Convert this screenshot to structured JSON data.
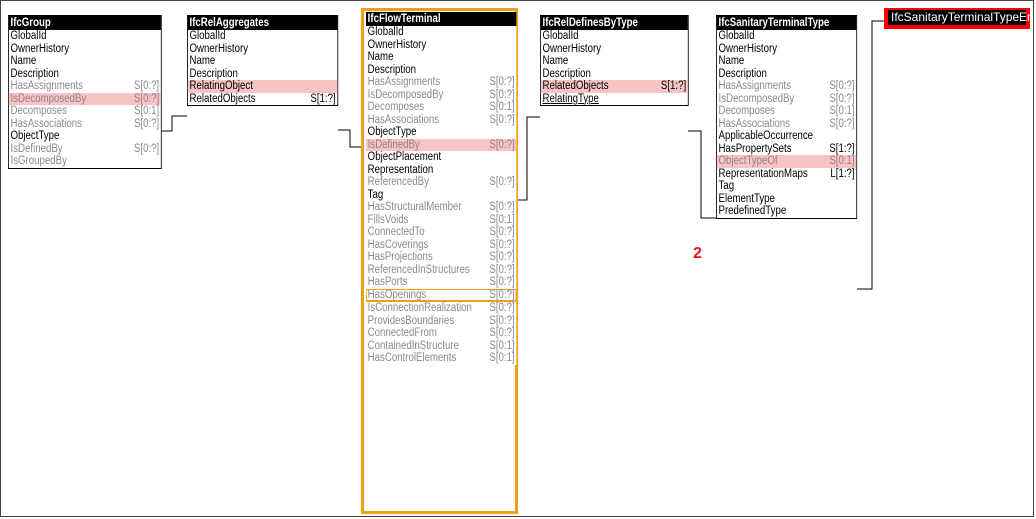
{
  "entities": [
    {
      "title": "IfcGroup",
      "rows": [
        {
          "name": "GlobalId",
          "card": ""
        },
        {
          "name": "OwnerHistory",
          "card": ""
        },
        {
          "name": "Name",
          "card": ""
        },
        {
          "name": "Description",
          "card": ""
        },
        {
          "name": "HasAssignments",
          "card": "S[0:?]",
          "inverse": true
        },
        {
          "name": "IsDecomposedBy",
          "card": "S[0:?]",
          "inverse": true,
          "highlight": true
        },
        {
          "name": "Decomposes",
          "card": "S[0:1]",
          "inverse": true
        },
        {
          "name": "HasAssociations",
          "card": "S[0:?]",
          "inverse": true
        },
        {
          "name": "ObjectType",
          "card": ""
        },
        {
          "name": "IsDefinedBy",
          "card": "S[0:?]",
          "inverse": true
        },
        {
          "name": "IsGroupedBy",
          "card": "",
          "inverse": true
        }
      ]
    },
    {
      "title": "IfcRelAggregates",
      "rows": [
        {
          "name": "GlobalId",
          "card": ""
        },
        {
          "name": "OwnerHistory",
          "card": ""
        },
        {
          "name": "Name",
          "card": ""
        },
        {
          "name": "Description",
          "card": ""
        },
        {
          "name": "RelatingObject",
          "card": "",
          "highlight": true
        },
        {
          "name": "RelatedObjects",
          "card": "S[1:?]"
        }
      ]
    },
    {
      "title": "IfcFlowTerminal",
      "rows": [
        {
          "name": "GlobalId",
          "card": ""
        },
        {
          "name": "OwnerHistory",
          "card": ""
        },
        {
          "name": "Name",
          "card": ""
        },
        {
          "name": "Description",
          "card": ""
        },
        {
          "name": "HasAssignments",
          "card": "S[0:?]",
          "inverse": true
        },
        {
          "name": "IsDecomposedBy",
          "card": "S[0:?]",
          "inverse": true
        },
        {
          "name": "Decomposes",
          "card": "S[0:1]",
          "inverse": true
        },
        {
          "name": "HasAssociations",
          "card": "S[0:?]",
          "inverse": true
        },
        {
          "name": "ObjectType",
          "card": ""
        },
        {
          "name": "IsDefinedBy",
          "card": "S[0:?]",
          "inverse": true,
          "highlight": true
        },
        {
          "name": "ObjectPlacement",
          "card": ""
        },
        {
          "name": "Representation",
          "card": ""
        },
        {
          "name": "ReferencedBy",
          "card": "S[0:?]",
          "inverse": true
        },
        {
          "name": "Tag",
          "card": ""
        },
        {
          "name": "HasStructuralMember",
          "card": "S[0:?]",
          "inverse": true
        },
        {
          "name": "FillsVoids",
          "card": "S[0:1]",
          "inverse": true
        },
        {
          "name": "ConnectedTo",
          "card": "S[0:?]",
          "inverse": true
        },
        {
          "name": "HasCoverings",
          "card": "S[0:?]",
          "inverse": true
        },
        {
          "name": "HasProjections",
          "card": "S[0:?]",
          "inverse": true
        },
        {
          "name": "ReferencedInStructures",
          "card": "S[0:?]",
          "inverse": true
        },
        {
          "name": "HasPorts",
          "card": "S[0:?]",
          "inverse": true
        },
        {
          "name": "HasOpenings",
          "card": "S[0:?]",
          "inverse": true,
          "boxed": true
        },
        {
          "name": "IsConnectionRealization",
          "card": "S[0:?]",
          "inverse": true
        },
        {
          "name": "ProvidesBoundaries",
          "card": "S[0:?]",
          "inverse": true
        },
        {
          "name": "ConnectedFrom",
          "card": "S[0:?]",
          "inverse": true
        },
        {
          "name": "ContainedInStructure",
          "card": "S[0:1]",
          "inverse": true
        },
        {
          "name": "HasControlElements",
          "card": "S[0:1]",
          "inverse": true
        }
      ]
    },
    {
      "title": "IfcRelDefinesByType",
      "rows": [
        {
          "name": "GlobalId",
          "card": ""
        },
        {
          "name": "OwnerHistory",
          "card": ""
        },
        {
          "name": "Name",
          "card": ""
        },
        {
          "name": "Description",
          "card": ""
        },
        {
          "name": "RelatedObjects",
          "card": "S[1:?]",
          "highlight": true
        },
        {
          "name": "RelatingType",
          "card": ""
        }
      ]
    },
    {
      "title": "IfcSanitaryTerminalType",
      "rows": [
        {
          "name": "GlobalId",
          "card": ""
        },
        {
          "name": "OwnerHistory",
          "card": ""
        },
        {
          "name": "Name",
          "card": ""
        },
        {
          "name": "Description",
          "card": ""
        },
        {
          "name": "HasAssignments",
          "card": "S[0:?]",
          "inverse": true
        },
        {
          "name": "IsDecomposedBy",
          "card": "S[0:?]",
          "inverse": true
        },
        {
          "name": "Decomposes",
          "card": "S[0:1]",
          "inverse": true
        },
        {
          "name": "HasAssociations",
          "card": "S[0:?]",
          "inverse": true
        },
        {
          "name": "ApplicableOccurrence",
          "card": ""
        },
        {
          "name": "HasPropertySets",
          "card": "S[1:?]"
        },
        {
          "name": "ObjectTypeOf",
          "card": "S[0:1]",
          "inverse": true,
          "highlight": true
        },
        {
          "name": "RepresentationMaps",
          "card": "L[1:?]"
        },
        {
          "name": "Tag",
          "card": ""
        },
        {
          "name": "ElementType",
          "card": ""
        },
        {
          "name": "PredefinedType",
          "card": ""
        }
      ]
    }
  ],
  "enum_label": "IfcSanitaryTerminalTypeEnum",
  "marker_label": "2",
  "colors": {
    "highlight": "#f6c4c4",
    "inverse_text": "#8a8a8a",
    "focus_frame": "#f0a018",
    "enum_border": "#ff0000"
  }
}
